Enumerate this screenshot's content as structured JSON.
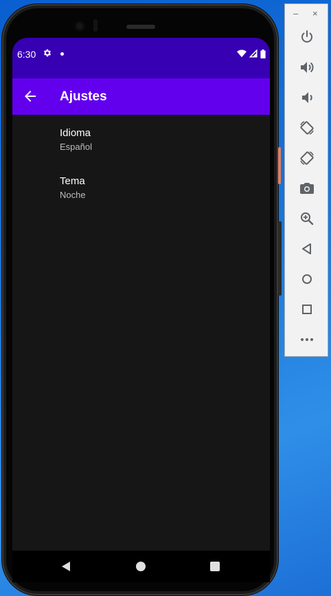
{
  "status_bar": {
    "time": "6:30",
    "icons": [
      "gear-icon",
      "dot-icon",
      "wifi-icon",
      "cell-signal-icon",
      "battery-icon"
    ]
  },
  "app_bar": {
    "title": "Ajustes",
    "back_icon": "arrow-back-icon"
  },
  "preferences": [
    {
      "title": "Idioma",
      "summary": "Español"
    },
    {
      "title": "Tema",
      "summary": "Noche"
    }
  ],
  "nav_bar": {
    "icons": [
      "back-triangle-icon",
      "home-circle-icon",
      "overview-square-icon"
    ]
  },
  "emulator_toolbar": {
    "minimize_label": "–",
    "close_label": "×",
    "buttons": [
      "power-icon",
      "volume-up-icon",
      "volume-down-icon",
      "rotate-left-icon",
      "rotate-right-icon",
      "camera-icon",
      "zoom-icon",
      "back-icon",
      "home-icon",
      "overview-icon",
      "more-icon"
    ]
  },
  "colors": {
    "status_bar": "#3700b3",
    "app_bar": "#6200ee",
    "screen_background": "#161616",
    "desktop": "#1976d8"
  }
}
